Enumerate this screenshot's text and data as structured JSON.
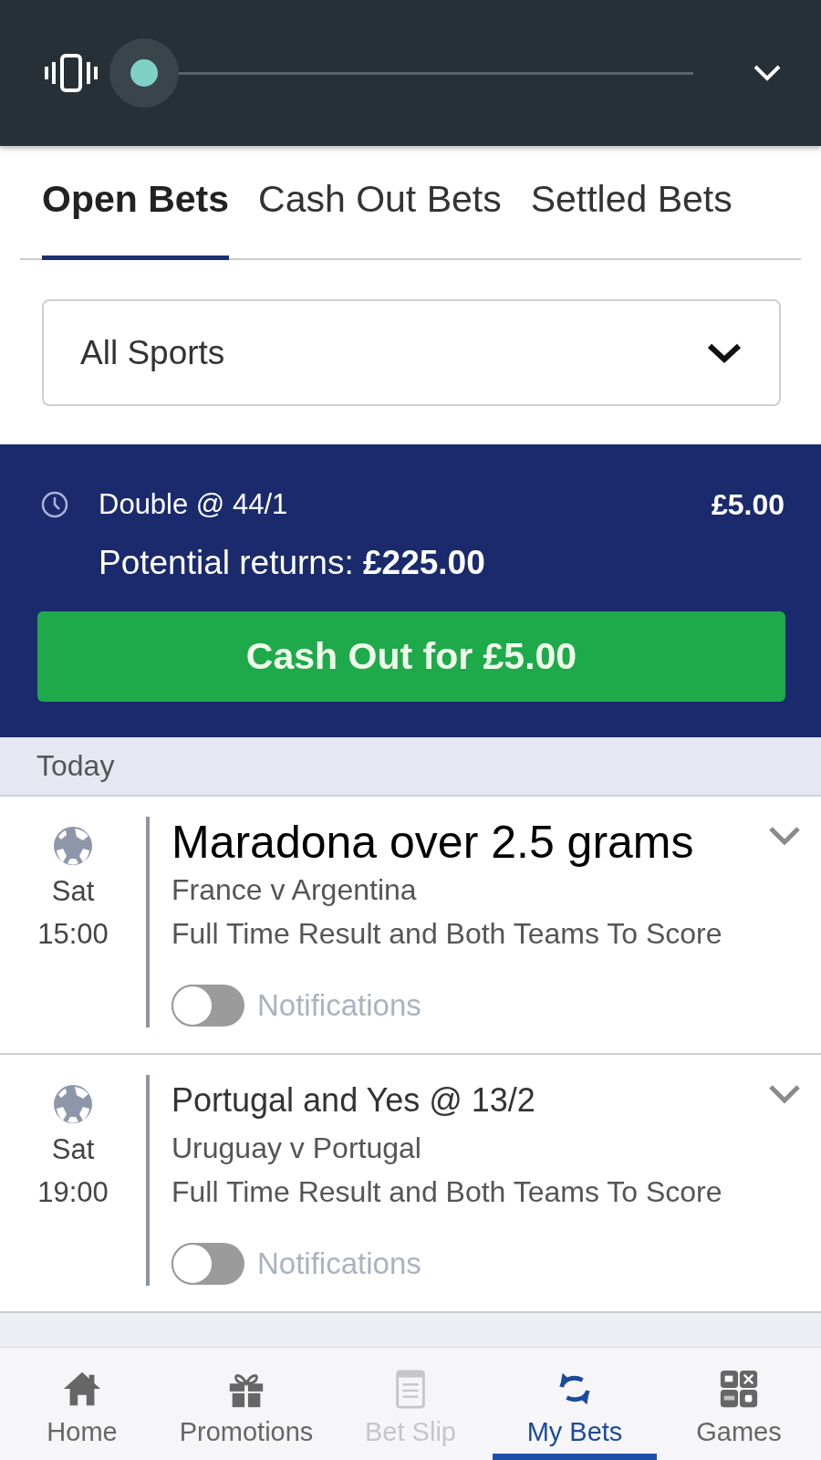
{
  "volume_panel": {
    "slider": {
      "level": 0
    }
  },
  "tabs": [
    {
      "label": "Open Bets",
      "selected": true
    },
    {
      "label": "Cash Out Bets",
      "selected": false
    },
    {
      "label": "Settled Bets",
      "selected": false
    }
  ],
  "sport_filter": {
    "value": "All Sports"
  },
  "cash_out_card": {
    "bet_type": "Double @ 44/1",
    "stake": "£5.00",
    "potential_returns": "Potential returns: **£225.00**",
    "cash_out_button": "Cash Out for £5.00"
  },
  "section_header": "Today",
  "bets": [
    {
      "kind": "large",
      "day": "Sat",
      "time": "15:00",
      "selection": "Maradona over 2.5 grams",
      "event": "France v Argentina",
      "market": "Full Time Result and Both Teams To Score",
      "notifications": {
        "label": "Notifications",
        "on": false
      },
      "expanded": false
    },
    {
      "kind": "standard",
      "day": "Sat",
      "time": "19:00",
      "selection": "Portugal and Yes @ 13/2",
      "event": "Uruguay v Portugal",
      "market": "Full Time Result and Both Teams To Score",
      "notifications": {
        "label": "Notifications",
        "on": false
      },
      "expanded": false
    }
  ],
  "bottom_nav": [
    {
      "label": "Home",
      "selected": false,
      "disabled": false
    },
    {
      "label": "Promotions",
      "selected": false,
      "disabled": false
    },
    {
      "label": "Bet Slip",
      "selected": false,
      "disabled": true
    },
    {
      "label": "My Bets",
      "selected": true,
      "disabled": false
    },
    {
      "label": "Games",
      "selected": false,
      "disabled": false
    }
  ]
}
